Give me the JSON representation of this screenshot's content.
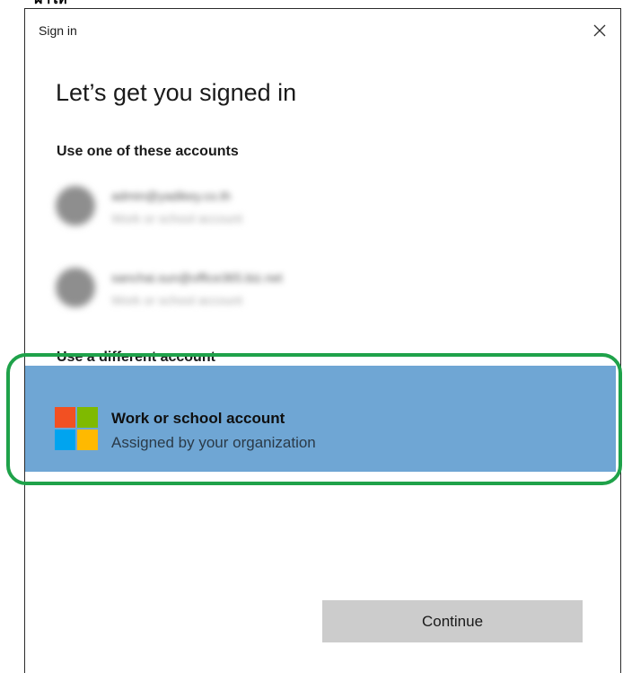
{
  "page_fragment": "ฝาให้",
  "dialog": {
    "title": "Sign in",
    "close_glyph": "✕",
    "heading": "Let’s get you signed in",
    "accounts_section_label": "Use one of these accounts",
    "accounts": [
      {
        "email": "admin@yadikey.co.th",
        "type": "Work or school account"
      },
      {
        "email": "sanchai.sun@office365.biz.net",
        "type": "Work or school account"
      }
    ],
    "different_account_label": "Use a different account",
    "work_option": {
      "title": "Work or school account",
      "subtitle": "Assigned by your organization",
      "logo_icon": "microsoft-logo-icon",
      "selected_background": "#6fa6d4"
    },
    "continue_label": "Continue"
  },
  "colors": {
    "highlight_ring": "#1fa24a",
    "continue_button": "#cccccc",
    "logo_red": "#f25022",
    "logo_green": "#7fba00",
    "logo_blue": "#00a4ef",
    "logo_yellow": "#ffb900"
  }
}
